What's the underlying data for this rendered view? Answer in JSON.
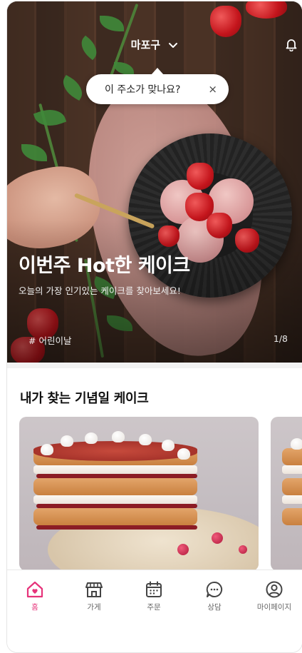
{
  "header": {
    "location": "마포구",
    "tooltip_text": "이 주소가 맞나요?",
    "tooltip_close": "×"
  },
  "hero": {
    "title": "이번주 Hot한 케이크",
    "subtitle": "오늘의 가장 인기있는 케이크를 찾아보세요!",
    "tag": "# 어린이날",
    "counter": "1/8"
  },
  "section": {
    "title": "내가 찾는 기념일 케이크"
  },
  "nav": {
    "items": [
      {
        "label": "홈",
        "icon": "home-heart-icon",
        "active": true
      },
      {
        "label": "가게",
        "icon": "store-icon",
        "active": false
      },
      {
        "label": "주문",
        "icon": "calendar-icon",
        "active": false
      },
      {
        "label": "상담",
        "icon": "chat-bubble-icon",
        "active": false
      },
      {
        "label": "마이페이지",
        "icon": "user-circle-icon",
        "active": false
      }
    ]
  },
  "colors": {
    "accent": "#e6337a",
    "nav_inactive": "#444444"
  }
}
